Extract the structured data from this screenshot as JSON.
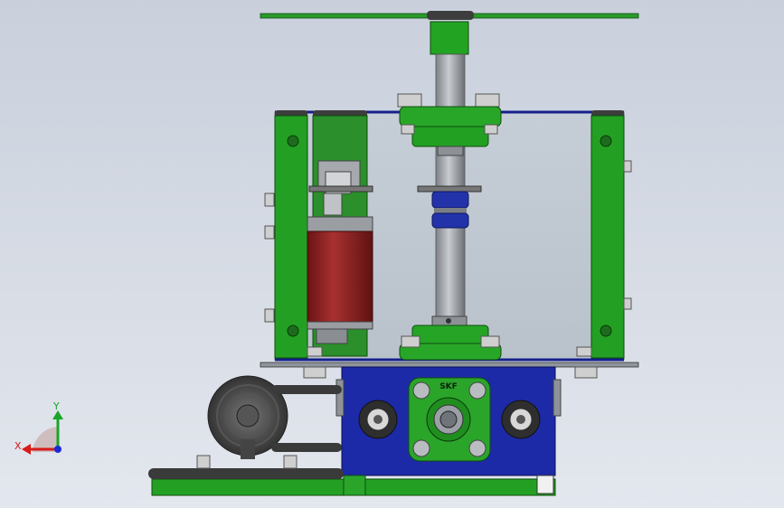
{
  "viewport": {
    "background_top": "#c9d0dc",
    "background_bottom": "#e3e7ee"
  },
  "triad": {
    "x_label": "X",
    "y_label": "Y",
    "x_color": "#d81a1a",
    "y_color": "#1aa52a",
    "z_color": "#1a2ad8"
  },
  "bearing": {
    "brand": "SKF"
  },
  "colors": {
    "frame_green": "#22a222",
    "frame_dark": "#0f5f0f",
    "plate_blue": "#1c2aa8",
    "glass": "#b9c2cc",
    "motor_red": "#8e1e1e",
    "shaft_grey": "#9a9ea4",
    "coupling_blue": "#2233aa",
    "chain_dark": "#3a3a3a"
  },
  "icons": [
    "coordinate-triad-icon"
  ]
}
